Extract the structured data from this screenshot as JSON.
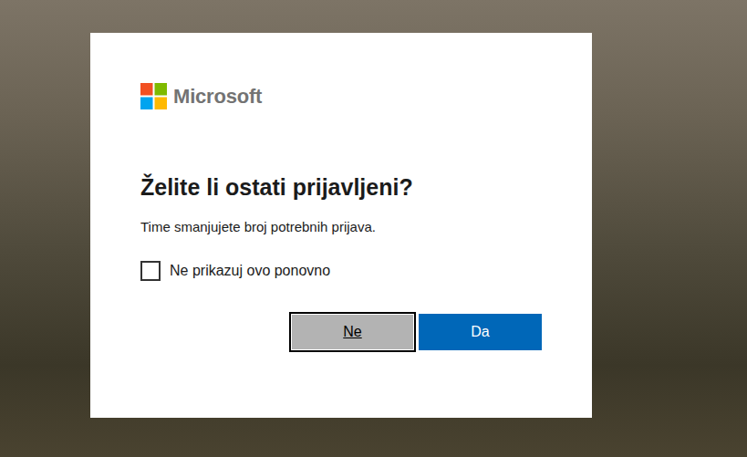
{
  "logo": {
    "text": "Microsoft"
  },
  "dialog": {
    "title": "Želite li ostati prijavljeni?",
    "description": "Time smanjujete broj potrebnih prijava."
  },
  "checkbox": {
    "label": "Ne prikazuj ovo ponovno",
    "checked": false
  },
  "buttons": [
    {
      "label": "Ne",
      "kind": "secondary",
      "focused": true
    },
    {
      "label": "Da",
      "kind": "primary",
      "focused": false
    }
  ]
}
